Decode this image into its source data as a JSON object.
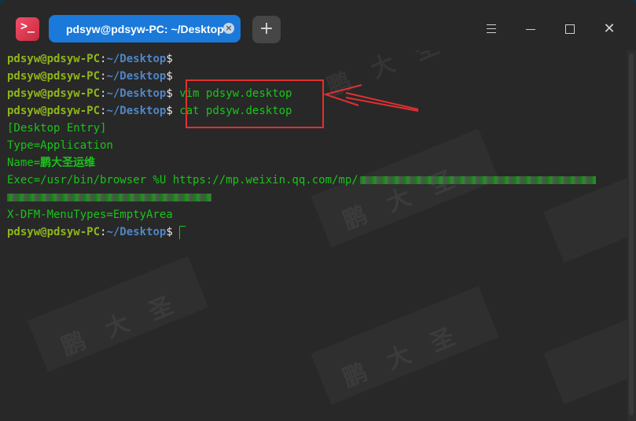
{
  "window": {
    "tab_title": "pdsyw@pdsyw-PC: ~/Desktop",
    "tab_close_glyph": "×",
    "new_tab_glyph": "+",
    "close_glyph": "✕"
  },
  "prompt": {
    "user_host": "pdsyw@pdsyw-PC",
    "colon": ":",
    "path": "~/Desktop",
    "dollar": "$"
  },
  "commands": {
    "vim": "vim pdsyw.desktop",
    "cat": "cat pdsyw.desktop"
  },
  "output": {
    "entry": "[Desktop Entry]",
    "type": "Type=Application",
    "name_key": "Name=",
    "name_value": "鹏大圣运维",
    "exec": "Exec=/usr/bin/browser %U https://mp.weixin.qq.com/mp/",
    "menu_types": "X-DFM-MenuTypes=EmptyArea"
  },
  "watermark": {
    "text": "鹏大圣"
  },
  "colors": {
    "background": "#282828",
    "user": "#8fb61a",
    "path": "#4f86c6",
    "command": "#19c419",
    "tab": "#1a79d9",
    "annotation": "#e13030"
  }
}
